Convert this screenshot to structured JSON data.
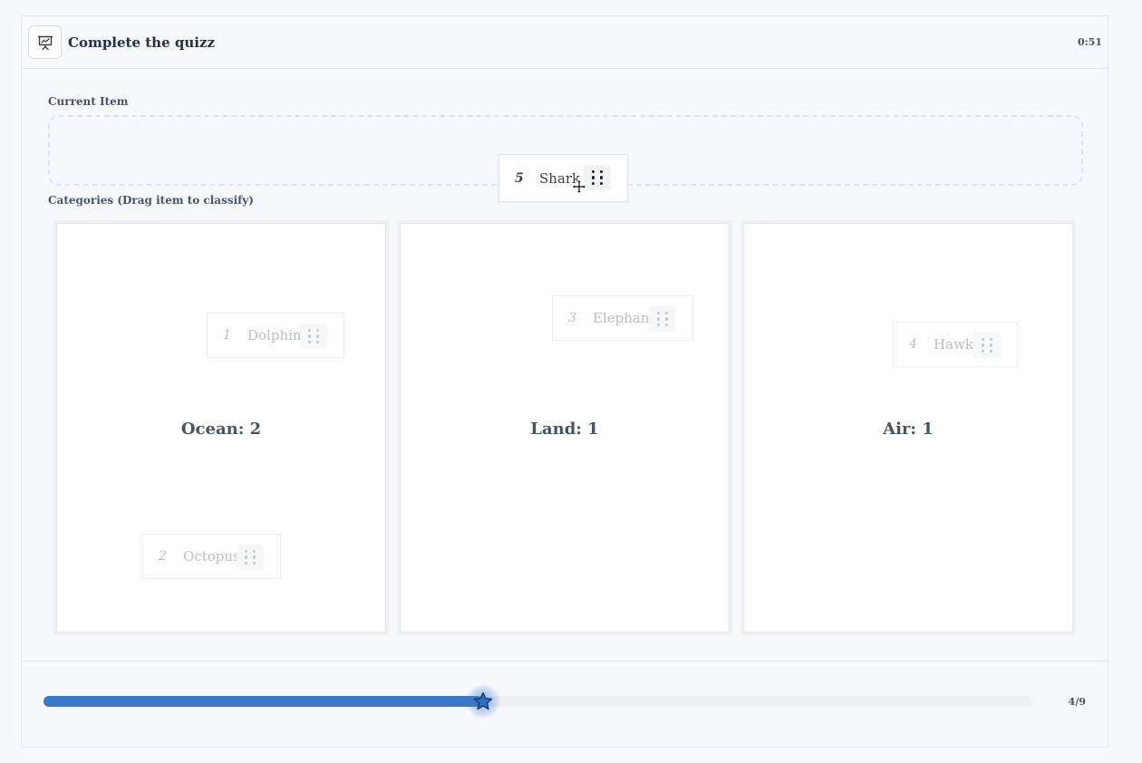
{
  "header": {
    "title": "Complete the quizz",
    "timer": "0:51",
    "logo_icon": "presentation-chart-icon"
  },
  "current_item_section": {
    "label": "Current Item",
    "item": {
      "number": "5",
      "name": "Shark"
    }
  },
  "categories_section": {
    "label": "Categories (Drag item to classify)",
    "categories": [
      {
        "label": "Ocean: 2",
        "items": [
          {
            "number": "1",
            "name": "Dolphin"
          },
          {
            "number": "2",
            "name": "Octopus"
          }
        ]
      },
      {
        "label": "Land: 1",
        "items": [
          {
            "number": "3",
            "name": "Elephant"
          }
        ]
      },
      {
        "label": "Air: 1",
        "items": [
          {
            "number": "4",
            "name": "Hawk"
          }
        ]
      }
    ]
  },
  "progress": {
    "count_text": "4/9",
    "fraction": 0.444,
    "knob_icon": "star-icon",
    "accent_color": "#3a79c8"
  }
}
